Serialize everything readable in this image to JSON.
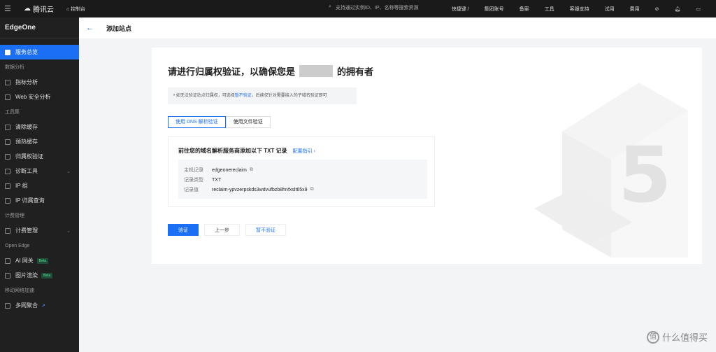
{
  "topbar": {
    "brand": "腾讯云",
    "console": "控制台",
    "search_placeholder": "支持通过实例ID、IP、名称等搜索资源",
    "shortcut": "快捷键 /",
    "items": [
      "集团账号",
      "备案",
      "工具",
      "客服支持",
      "试用",
      "费用"
    ]
  },
  "sidebar": {
    "product": "EdgeOne",
    "overview": "服务总览",
    "groups": [
      {
        "label": "数据分析",
        "items": [
          {
            "label": "指标分析"
          },
          {
            "label": "Web 安全分析"
          }
        ]
      },
      {
        "label": "工具集",
        "items": [
          {
            "label": "清除缓存"
          },
          {
            "label": "预热缓存"
          },
          {
            "label": "归属权验证"
          },
          {
            "label": "诊断工具",
            "expand": true
          },
          {
            "label": "IP 组"
          },
          {
            "label": "IP 归属查询"
          }
        ]
      },
      {
        "label": "计费管理",
        "items": [
          {
            "label": "计费管理",
            "expand": true
          }
        ]
      },
      {
        "label": "Open Edge",
        "items": [
          {
            "label": "AI 网关",
            "badge": "Beta"
          },
          {
            "label": "图片渲染",
            "badge": "Beta"
          }
        ]
      },
      {
        "label": "移动网络加速",
        "items": [
          {
            "label": "多网聚合",
            "external": true
          }
        ]
      }
    ]
  },
  "header": {
    "title": "添加站点"
  },
  "main": {
    "heading_prefix": "请进行归属权验证，以确保您是",
    "heading_suffix": "的拥有者",
    "tip_prefix": "• 如无法验证站点归属权，可选择",
    "tip_link": "暂不验证",
    "tip_suffix": "，后续仅针对需要接入的子域名验证即可",
    "tabs": [
      {
        "label": "使用 DNS 解析验证",
        "active": true
      },
      {
        "label": "使用文件验证",
        "active": false
      }
    ],
    "record_title": "前往您的域名解析服务商添加以下 TXT 记录",
    "guide_link": "配置指引 ›",
    "records": [
      {
        "key": "主机记录",
        "value": "edgeonereclaim",
        "copy": true
      },
      {
        "key": "记录类型",
        "value": "TXT",
        "copy": false
      },
      {
        "key": "记录值",
        "value": "reclaim-ypvzerpskds3wdvufbzb8hnfxslt65x9",
        "copy": true
      }
    ],
    "buttons": {
      "verify": "验证",
      "prev": "上一步",
      "skip": "暂不验证"
    }
  },
  "watermark": "值 什么值得买"
}
